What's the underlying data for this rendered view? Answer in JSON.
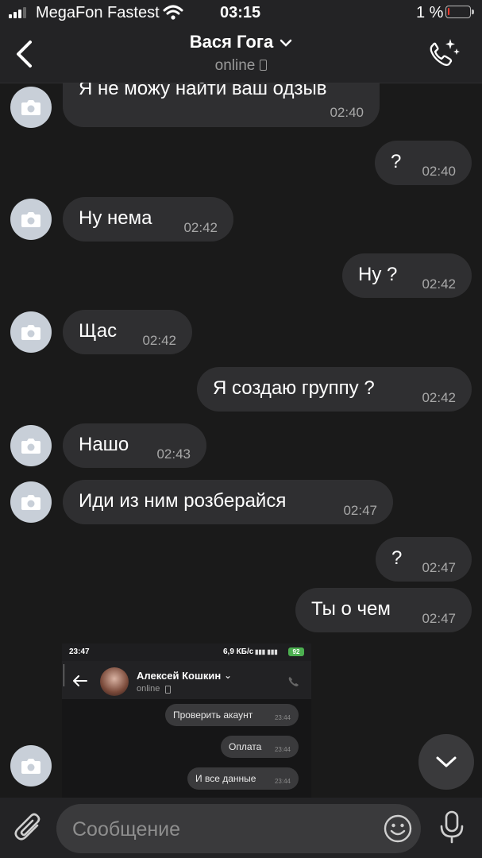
{
  "status_bar": {
    "carrier": "MegaFon Fastest",
    "time": "03:15",
    "battery": "1 %"
  },
  "header": {
    "title": "Вася Гога",
    "subtitle": "online"
  },
  "messages": [
    {
      "side": "in",
      "text": "Я не можу найти ваш одзыв",
      "time": "02:40"
    },
    {
      "side": "out",
      "text": "?",
      "time": "02:40"
    },
    {
      "side": "in",
      "text": "Ну нема",
      "time": "02:42"
    },
    {
      "side": "out",
      "text": "Ну ?",
      "time": "02:42"
    },
    {
      "side": "in",
      "text": "Щас",
      "time": "02:42"
    },
    {
      "side": "out",
      "text": "Я создаю группу ?",
      "time": "02:42"
    },
    {
      "side": "in",
      "text": "Нашо",
      "time": "02:43"
    },
    {
      "side": "in",
      "text": "Иди из ним розберайся",
      "time": "02:47"
    },
    {
      "side": "out",
      "text": "?",
      "time": "02:47"
    },
    {
      "side": "out",
      "text": "Ты о чем",
      "time": "02:47"
    }
  ],
  "embedded_screenshot": {
    "time": "23:47",
    "speed": "6,9 КБ/с",
    "battery": "92",
    "contact_name": "Алексей Кошкин",
    "contact_status": "online",
    "bubbles": [
      {
        "text": "Проверить акаунт",
        "time": "23:44"
      },
      {
        "text": "Оплата",
        "time": "23:44"
      },
      {
        "text": "И все данные",
        "time": "23:44"
      }
    ]
  },
  "input": {
    "placeholder": "Сообщение"
  },
  "colors": {
    "background": "#1a1a1a",
    "bubble": "#2f2f31",
    "bar": "#232325",
    "battery_low": "#ff3b30"
  }
}
